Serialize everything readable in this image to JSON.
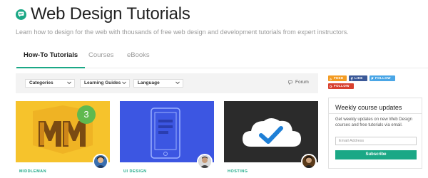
{
  "header": {
    "title": "Web Design Tutorials",
    "subtitle": "Learn how to design for the web with thousands of free web design and development tutorials from expert instructors."
  },
  "tabs": [
    {
      "label": "How-To Tutorials",
      "active": true
    },
    {
      "label": "Courses",
      "active": false
    },
    {
      "label": "eBooks",
      "active": false
    }
  ],
  "filters": {
    "categories": "Categories",
    "learning_guides": "Learning Guides",
    "language": "Language",
    "forum": "Forum"
  },
  "cards": [
    {
      "category": "MIDDLEMAN",
      "badge": "3",
      "color": "#f6c32c"
    },
    {
      "category": "UI DESIGN",
      "color": "#3c56e2"
    },
    {
      "category": "HOSTING",
      "color": "#2b2b2b"
    }
  ],
  "social": {
    "feed": "FEED",
    "like": "LIKE",
    "follow_twitter": "FOLLOW",
    "follow_google": "FOLLOW"
  },
  "newsletter": {
    "title": "Weekly course updates",
    "description": "Get weekly updates on new Web Design courses and free tutorials via email.",
    "email_placeholder": "Email Address",
    "subscribe_label": "Subscribe"
  },
  "colors": {
    "accent": "#1ba886"
  }
}
